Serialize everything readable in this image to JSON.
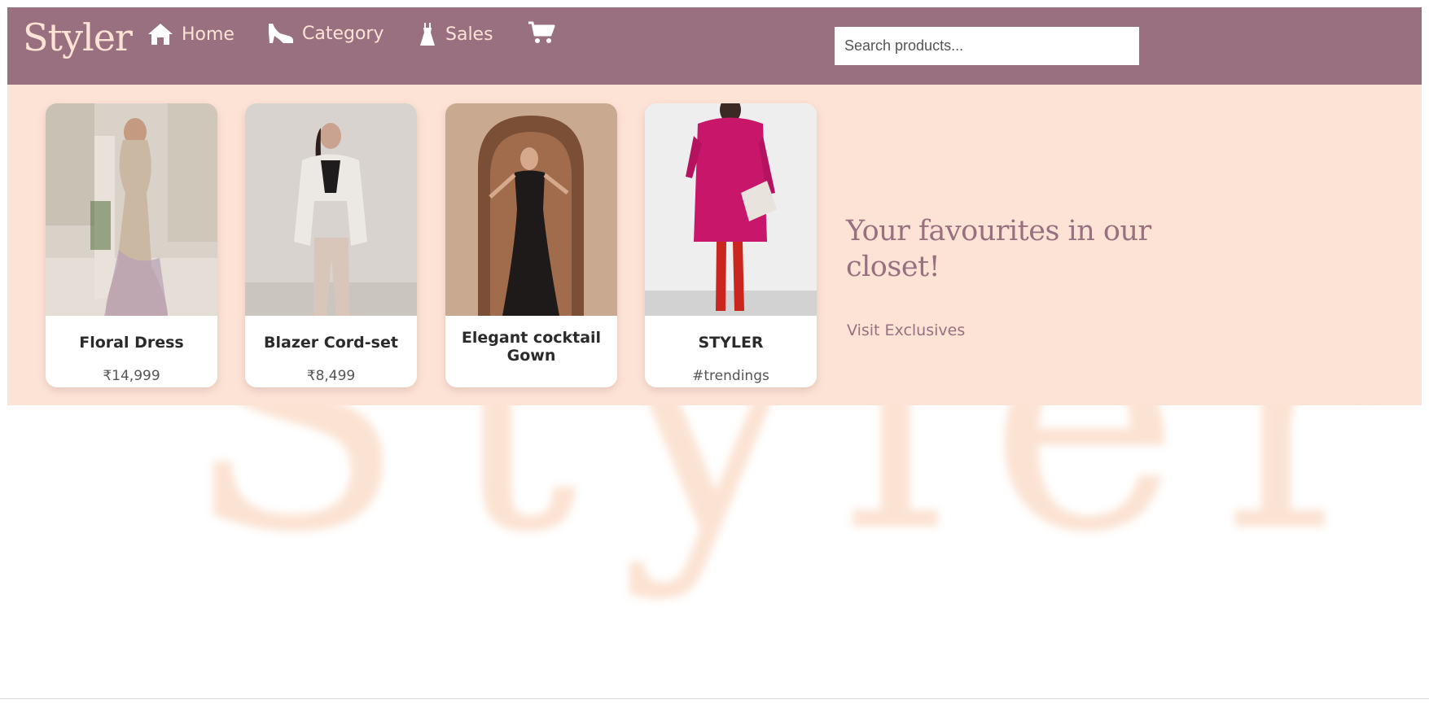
{
  "brand": {
    "logo": "Styler",
    "watermark": "Styler"
  },
  "nav": {
    "home": {
      "label": "Home",
      "icon": "home-icon"
    },
    "category": {
      "label": "Category",
      "icon": "heel-shoe-icon"
    },
    "sales": {
      "label": "Sales",
      "icon": "dress-icon"
    },
    "cart": {
      "icon": "cart-icon"
    }
  },
  "search": {
    "placeholder": "Search products...",
    "value": ""
  },
  "hero": {
    "tagline": "Your favourites in our closet!",
    "visit_link": "Visit Exclusives"
  },
  "products": [
    {
      "name": "Floral Dress",
      "subtitle": "₹14,999"
    },
    {
      "name": "Blazer Cord-set",
      "subtitle": "₹8,499"
    },
    {
      "name": "Elegant cocktail Gown",
      "subtitle": ""
    },
    {
      "name": "STYLER",
      "subtitle": "#trendings"
    }
  ],
  "colors": {
    "navbar": "#98707f",
    "hero_bg": "#fde3d6",
    "accent_text": "#98707f",
    "logo_text": "#fde3d6"
  }
}
